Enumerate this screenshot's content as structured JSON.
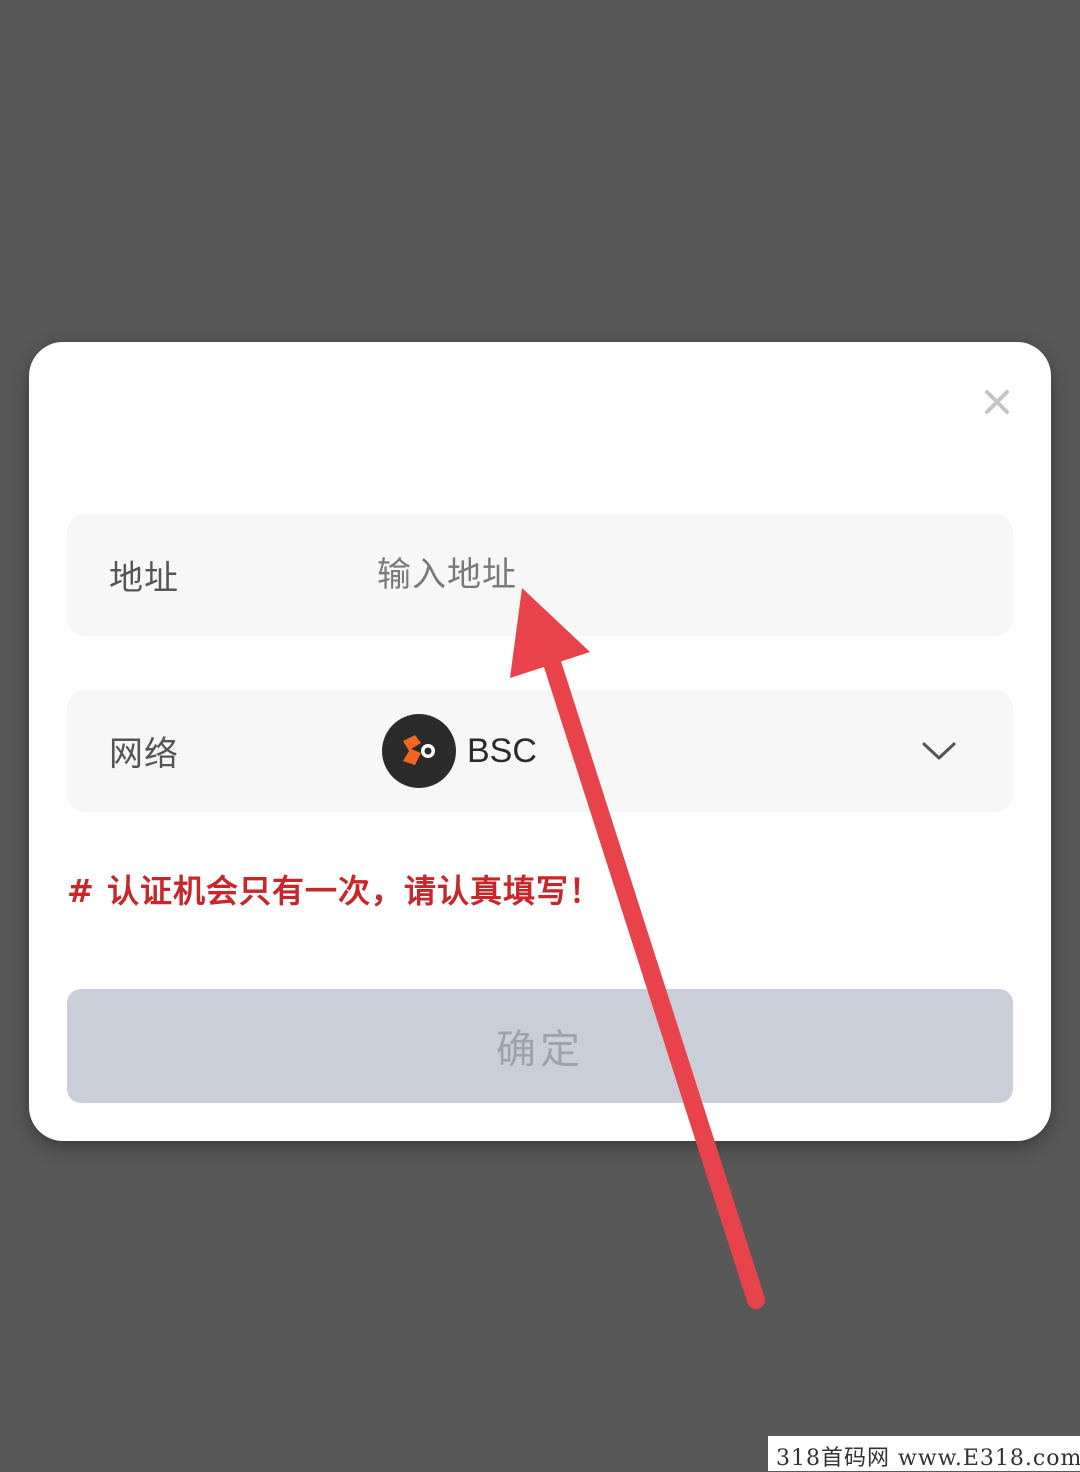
{
  "dialog": {
    "close_icon": "close-icon",
    "address": {
      "label": "地址",
      "placeholder": "输入地址",
      "value": ""
    },
    "network": {
      "label": "网络",
      "selected_value": "BSC",
      "logo_icon": "bsc-logo-icon",
      "dropdown_icon": "chevron-down-icon"
    },
    "warning_text": "# 认证机会只有一次，请认真填写！",
    "confirm_label": "确定"
  },
  "watermark": "318首码网 www.E318.com",
  "colors": {
    "backdrop": "#585858",
    "dialog_bg": "#ffffff",
    "field_bg": "#f7f7f7",
    "warning": "#c8262b",
    "button_disabled_bg": "#c9ced8",
    "button_disabled_text": "#9da2ab",
    "arrow": "#e8434a",
    "bsc_orange": "#f26522",
    "bsc_dark": "#2b2b2b"
  }
}
